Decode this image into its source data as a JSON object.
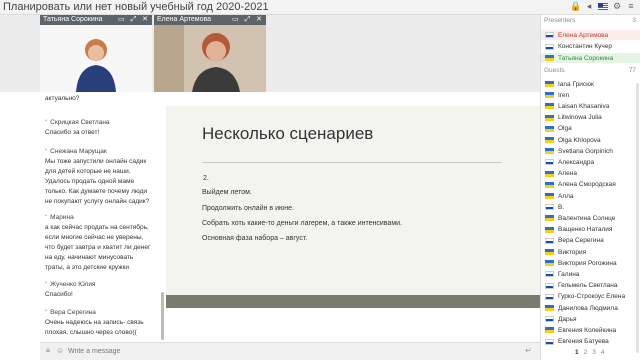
{
  "window": {
    "title": "Планировать или нет новый учебный год 2020-2021"
  },
  "videos": [
    {
      "name": "Татьяна Сорокина"
    },
    {
      "name": "Елена Артемова"
    }
  ],
  "chat": {
    "messages": [
      {
        "author": "",
        "lines": [
          "актуально?"
        ]
      },
      {
        "author": "Скрицкая Светлана",
        "lines": [
          "Спасибо за ответ!"
        ]
      },
      {
        "author": "Снежана Марущак",
        "lines": [
          "Мы тоже запустили онлайн садик",
          "для детей которые не наши.",
          "Удалось продать одной маме",
          "только. Как думаете почему люди",
          "не покупают услугу онлайн садик?"
        ]
      },
      {
        "author": "Марина",
        "lines": [
          "а как сейчас продать на сентябрь,",
          "если многие сейчас не уверены,",
          "что будет завтра и хватит ли денег",
          "на еду, начинают минусовать",
          "траты, а это детские кружки"
        ]
      },
      {
        "author": "Жученко Юлия",
        "lines": [
          "Спасибо!"
        ]
      },
      {
        "author": "Вера Серегина",
        "lines": [
          "Очень надеюсь на запись- связь",
          "плохая, слышно через слово(("
        ]
      }
    ],
    "input_placeholder": "Write a message"
  },
  "slide": {
    "title": "Несколько сценариев",
    "number": "2.",
    "items": [
      "Выйдем летом.",
      "Продолжить онлайн в июне.",
      "Собрать хоть какие-то деньги лагерем, а также интенсивами.",
      "Основная фаза набора – август."
    ]
  },
  "sidebar": {
    "presenters_label": "Presenters",
    "presenters_count": "3",
    "presenters": [
      {
        "name": "Елена Артемова",
        "flag": "ru",
        "color": "#c0392b",
        "highlight": "#fdecec"
      },
      {
        "name": "Константин Кучер",
        "flag": "ru",
        "color": "#333333",
        "highlight": ""
      },
      {
        "name": "Татьяна Сорокина",
        "flag": "ua",
        "color": "#2e8b3a",
        "highlight": "#e6f4e6"
      }
    ],
    "guests_label": "Guests",
    "guests_count": "77",
    "guests": [
      {
        "name": "Iana Грисюк",
        "flag": "ua"
      },
      {
        "name": "Iren",
        "flag": "ua"
      },
      {
        "name": "Laisan Khasanіva",
        "flag": "ua"
      },
      {
        "name": "Litwinowa Julia",
        "flag": "ua"
      },
      {
        "name": "Olga",
        "flag": "ua"
      },
      {
        "name": "Olga Khlopova",
        "flag": "ua"
      },
      {
        "name": "Svetlana Gorpinich",
        "flag": "ua"
      },
      {
        "name": "Александра",
        "flag": "ru"
      },
      {
        "name": "Алена",
        "flag": "ua"
      },
      {
        "name": "Алена Смородская",
        "flag": "ua"
      },
      {
        "name": "Алла",
        "flag": "ua"
      },
      {
        "name": "В.",
        "flag": "ru"
      },
      {
        "name": "Валентина Солнце",
        "flag": "ua"
      },
      {
        "name": "Ващенко Наталия",
        "flag": "ua"
      },
      {
        "name": "Вера Серегина",
        "flag": "ru"
      },
      {
        "name": "Виктория",
        "flag": "ua"
      },
      {
        "name": "Виктория Рогожина",
        "flag": "ua"
      },
      {
        "name": "Галина",
        "flag": "ru"
      },
      {
        "name": "Гельмель Светлана",
        "flag": "ru"
      },
      {
        "name": "Гурко-Строкоус Елена",
        "flag": "ru"
      },
      {
        "name": "Данилова Людмила",
        "flag": "ua"
      },
      {
        "name": "Дарья",
        "flag": "ru"
      },
      {
        "name": "Евгения Колейкина",
        "flag": "ua"
      },
      {
        "name": "Евгения Батуева",
        "flag": "ru"
      }
    ],
    "pages": [
      "1",
      "2",
      "3",
      "4"
    ]
  }
}
